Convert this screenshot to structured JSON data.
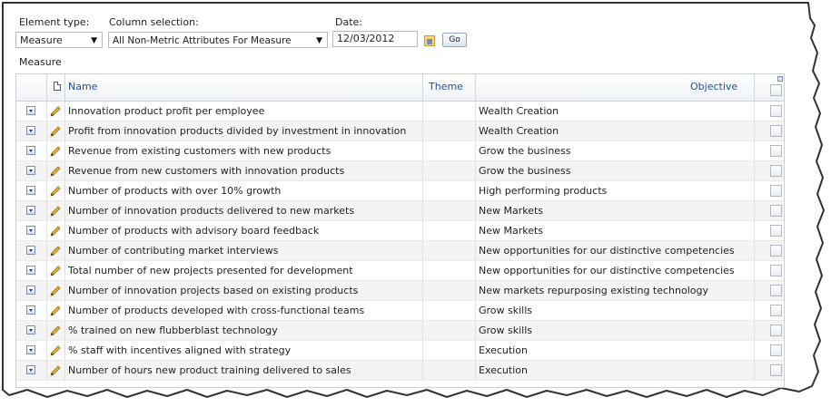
{
  "filters": {
    "element_type_label": "Element type:",
    "element_type_value": "Measure",
    "column_selection_label": "Column selection:",
    "column_selection_value": "All Non-Metric Attributes For Measure",
    "date_label": "Date:",
    "date_value": "12/03/2012",
    "go_label": "Go"
  },
  "section_title": "Measure",
  "grid": {
    "columns": {
      "name": "Name",
      "theme": "Theme",
      "objective": "Objective"
    },
    "rows": [
      {
        "name": "Innovation product profit per employee",
        "theme": "",
        "objective": "Wealth Creation"
      },
      {
        "name": "Profit from innovation products divided by investment in innovation",
        "theme": "",
        "objective": "Wealth Creation"
      },
      {
        "name": "Revenue from existing customers with new products",
        "theme": "",
        "objective": "Grow the business"
      },
      {
        "name": "Revenue from new customers with innovation products",
        "theme": "",
        "objective": "Grow the business"
      },
      {
        "name": "Number of products with over 10% growth",
        "theme": "",
        "objective": "High performing products"
      },
      {
        "name": "Number of innovation products delivered to new markets",
        "theme": "",
        "objective": "New Markets"
      },
      {
        "name": "Number of products with advisory board feedback",
        "theme": "",
        "objective": "New Markets"
      },
      {
        "name": "Number of contributing market interviews",
        "theme": "",
        "objective": "New opportunities for our distinctive competencies"
      },
      {
        "name": "Total number of new projects presented for development",
        "theme": "",
        "objective": "New opportunities for our distinctive competencies"
      },
      {
        "name": "Number of innovation projects based on existing products",
        "theme": "",
        "objective": "New markets repurposing existing technology"
      },
      {
        "name": "Number of products developed with cross-functional teams",
        "theme": "",
        "objective": "Grow skills"
      },
      {
        "name": "% trained on new flubberblast technology",
        "theme": "",
        "objective": "Grow skills"
      },
      {
        "name": "% staff with incentives aligned with strategy",
        "theme": "",
        "objective": "Execution"
      },
      {
        "name": "Number of hours new product training delivered to sales",
        "theme": "",
        "objective": "Execution"
      }
    ]
  },
  "colors": {
    "header_link": "#1f4c9a",
    "alt_row": "#f4f4f4",
    "grid_border": "#c6cfdb"
  }
}
